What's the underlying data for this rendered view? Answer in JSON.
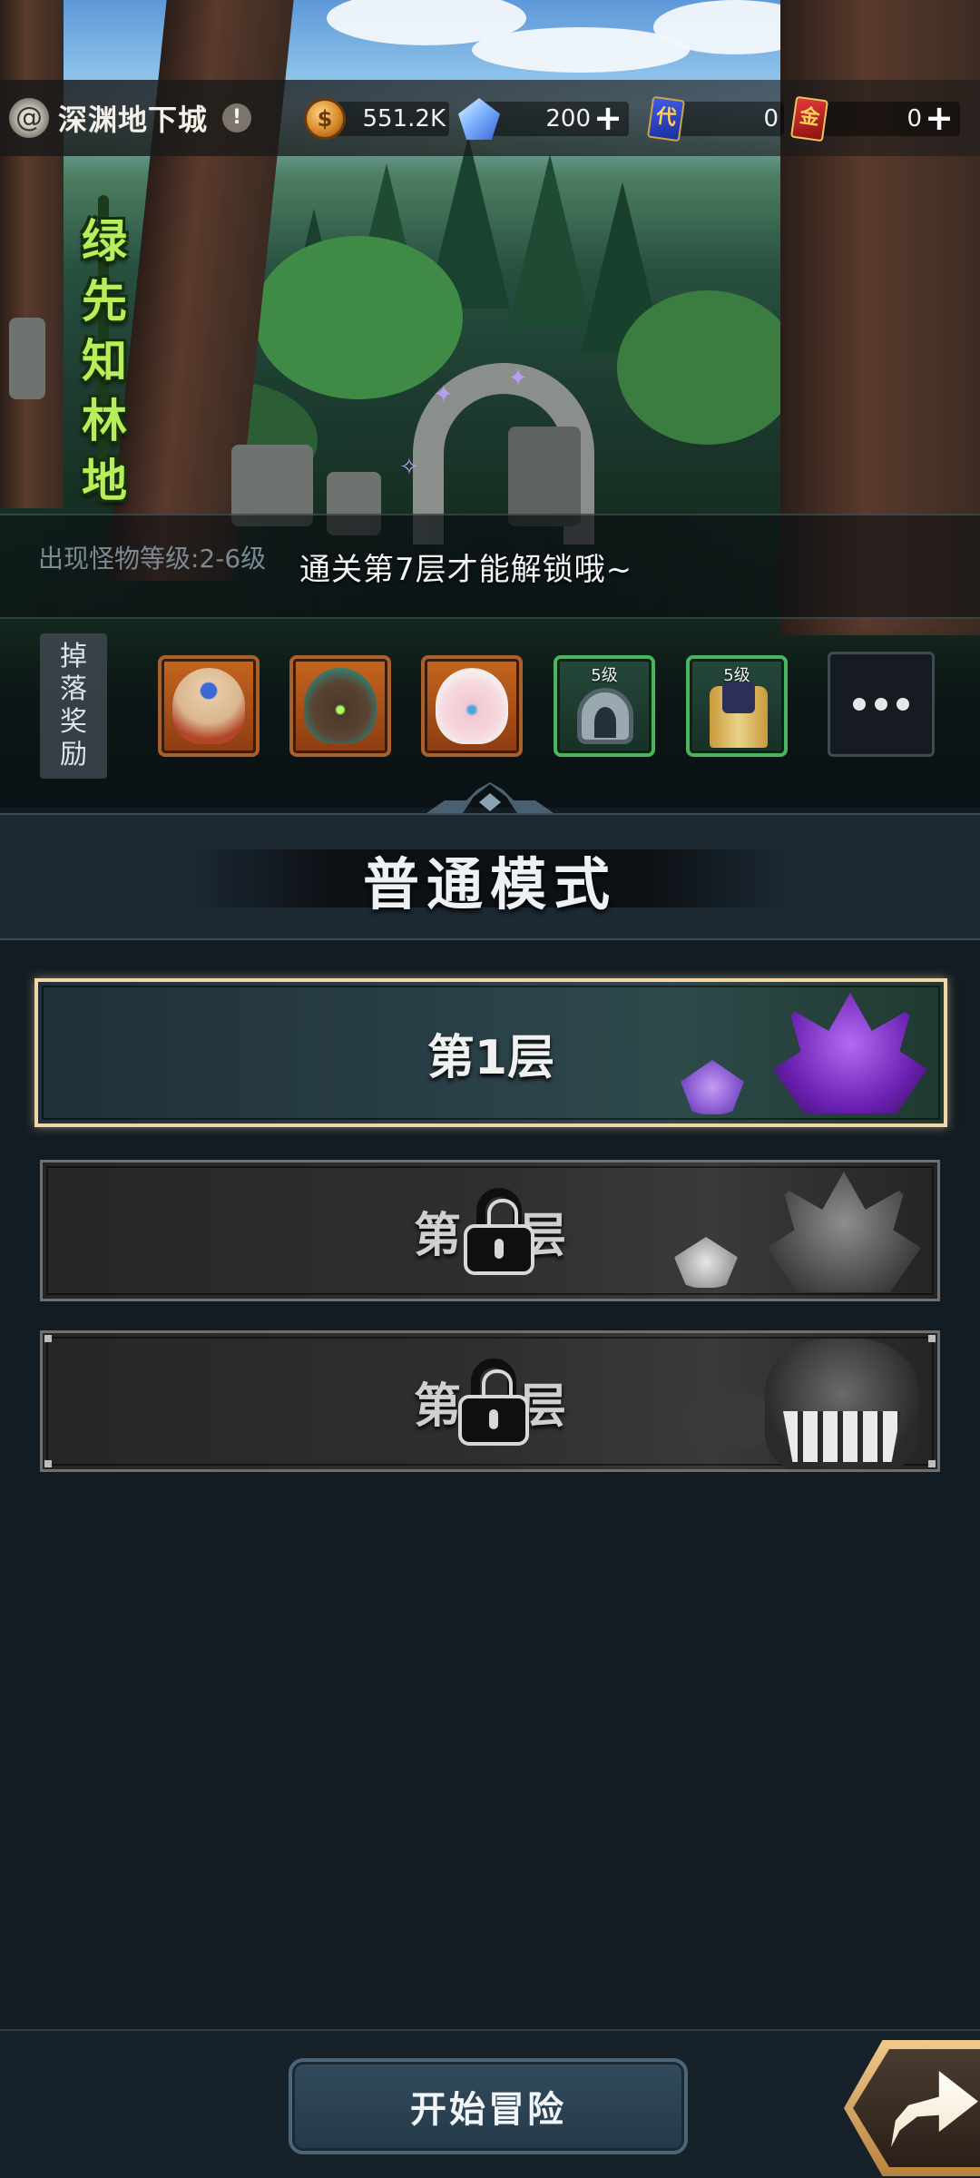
{
  "header": {
    "map_name": "深渊地下城",
    "info_icon": "exclamation-icon",
    "resources": [
      {
        "icon": "gold-coin-icon",
        "value": "551.2K",
        "has_plus": false
      },
      {
        "icon": "diamond-icon",
        "value": "200",
        "has_plus": true
      },
      {
        "icon": "blue-ticket-icon",
        "icon_text": "代",
        "value": "0",
        "has_plus": false
      },
      {
        "icon": "red-ticket-icon",
        "icon_text": "金",
        "value": "0",
        "has_plus": true
      }
    ]
  },
  "stage": {
    "title_chars": [
      "绿",
      "先",
      "知",
      "林",
      "地"
    ],
    "monster_level": "出现怪物等级:2-6级",
    "unlock_tip": "通关第7层才能解锁哦~"
  },
  "drops": {
    "label_chars": [
      "掉",
      "落",
      "奖",
      "励"
    ],
    "items": [
      {
        "icon": "hero-portrait-1",
        "rarity": "orange"
      },
      {
        "icon": "hero-portrait-2",
        "rarity": "orange"
      },
      {
        "icon": "hero-portrait-3",
        "rarity": "orange"
      },
      {
        "icon": "hood-equipment-icon",
        "rarity": "green",
        "level": "5级"
      },
      {
        "icon": "robe-equipment-icon",
        "rarity": "green",
        "level": "5级"
      }
    ],
    "more_icon": "more-dots-icon"
  },
  "mode": {
    "title": "普通模式"
  },
  "floors": [
    {
      "label": "第1层",
      "locked": false
    },
    {
      "label": "第2层",
      "visible_left": "第",
      "visible_right": "层",
      "locked": true
    },
    {
      "label": "第3层",
      "visible_left": "第",
      "visible_right": "层",
      "locked": true
    }
  ],
  "footer": {
    "start_label": "开始冒险",
    "share_icon": "share-arrow-icon"
  },
  "colors": {
    "accent_gold": "#f1d7a6",
    "button_blue": "#324b5d",
    "title_green": "#b7ee5a"
  }
}
